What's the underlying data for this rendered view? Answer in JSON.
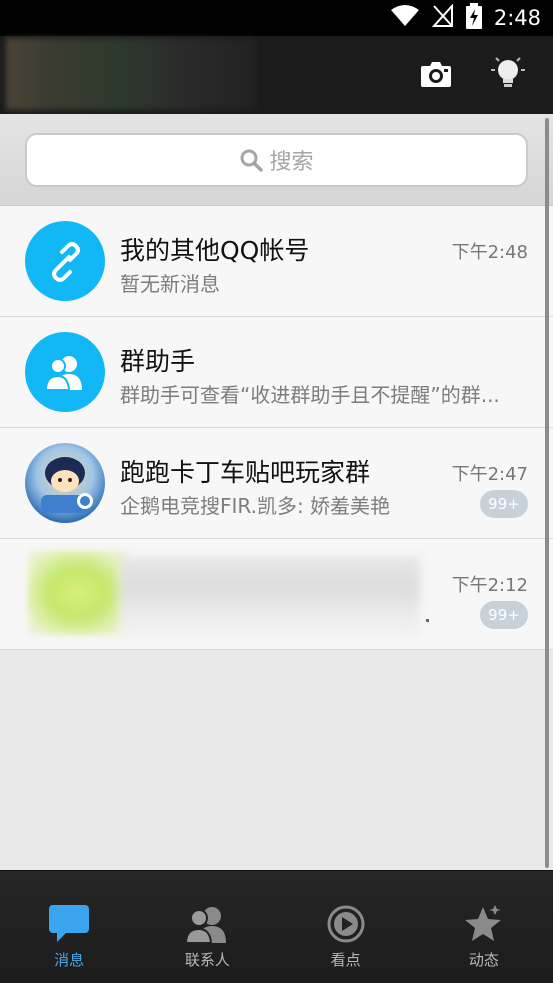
{
  "status_bar": {
    "time": "2:48",
    "icons": [
      "wifi-icon",
      "no-signal-icon",
      "battery-charging-icon"
    ]
  },
  "header": {
    "icons": [
      "camera-icon",
      "lightbulb-icon"
    ]
  },
  "search": {
    "placeholder": "搜索"
  },
  "conversations": [
    {
      "title": "我的其他QQ帐号",
      "subtitle": "暂无新消息",
      "time": "下午2:48",
      "badge": "",
      "avatar_icon": "link-icon",
      "avatar_color": "#12b7f5"
    },
    {
      "title": "群助手",
      "subtitle": "群助手可查看“收进群助手且不提醒”的群...",
      "time": "",
      "badge": "",
      "avatar_icon": "group-people-icon",
      "avatar_color": "#12b7f5"
    },
    {
      "title": "跑跑卡丁车贴吧玩家群",
      "subtitle": "企鹅电竞搜FIR.凯多: 娇羞美艳",
      "time": "下午2:47",
      "badge": "99+",
      "avatar_icon": "game-character-avatar"
    },
    {
      "title": "",
      "subtitle": "",
      "time": "下午2:12",
      "badge": "99+",
      "avatar_icon": "blurred-avatar"
    }
  ],
  "bottom_nav": [
    {
      "label": "消息",
      "icon": "message-icon",
      "active": true
    },
    {
      "label": "联系人",
      "icon": "contacts-icon",
      "active": false
    },
    {
      "label": "看点",
      "icon": "play-icon",
      "active": false
    },
    {
      "label": "动态",
      "icon": "star-icon",
      "active": false
    }
  ],
  "colors": {
    "accent": "#12b7f5",
    "nav_active": "#4aa7e8",
    "badge": "#c8d0da"
  }
}
